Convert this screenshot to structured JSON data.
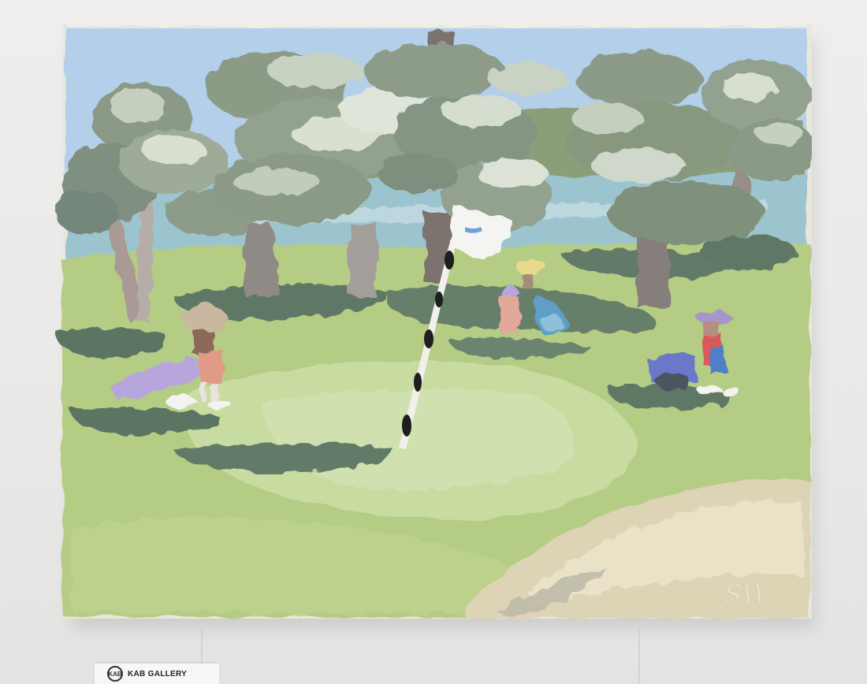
{
  "gallery_label": {
    "name": "KAB GALLERY",
    "logo_text": "KAB"
  },
  "painting": {
    "signature": "SW",
    "colors": {
      "sky": "#b3cfea",
      "water": "#9cc4cf",
      "fairway": "#b4cc83",
      "green": "#c4d89a",
      "tree_foliage": "#8a9a86",
      "tree_highlight": "#d9e0d2",
      "shadow": "#5f7866",
      "bunker": "#ddd3b5",
      "trunk": "#8f8a86"
    }
  }
}
